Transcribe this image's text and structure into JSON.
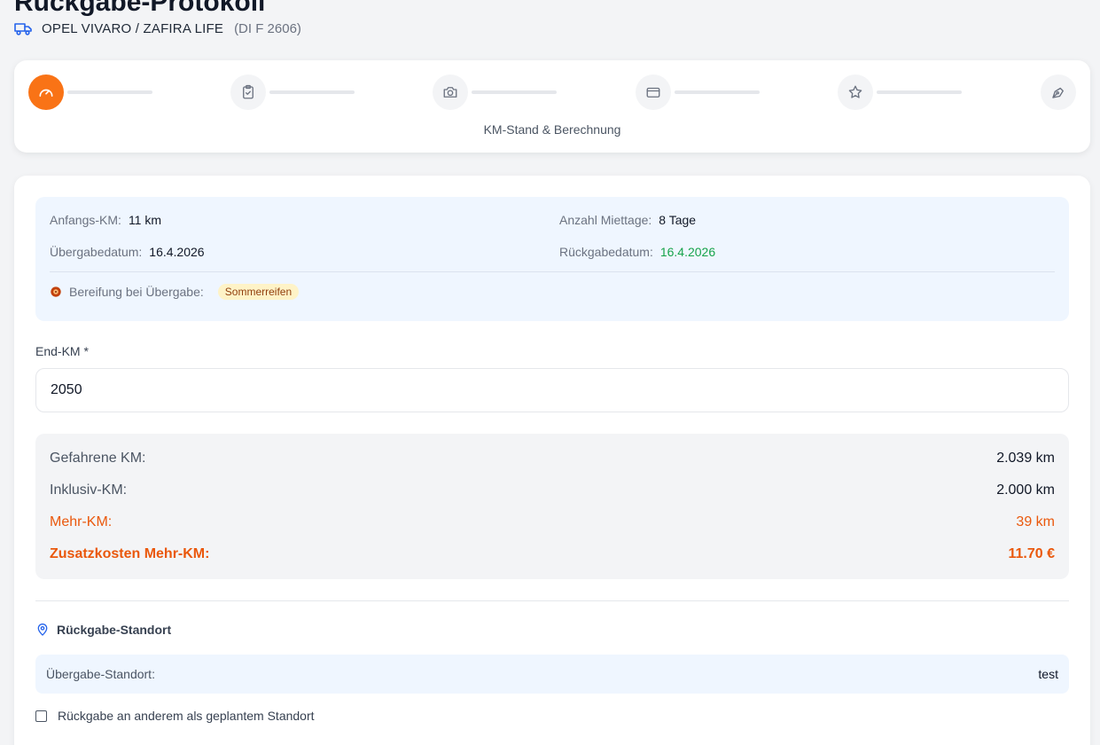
{
  "page": {
    "title": "Rückgabe-Protokoll",
    "vehicle_name": "OPEL VIVARO / ZAFIRA LIFE",
    "vehicle_plate": "(DI F 2606)"
  },
  "stepper": {
    "current_label": "KM-Stand & Berechnung",
    "steps": [
      {
        "icon": "speedometer-icon",
        "active": true
      },
      {
        "icon": "clipboard-check-icon",
        "active": false
      },
      {
        "icon": "camera-icon",
        "active": false
      },
      {
        "icon": "credit-card-icon",
        "active": false
      },
      {
        "icon": "star-icon",
        "active": false
      },
      {
        "icon": "signature-pen-icon",
        "active": false
      }
    ]
  },
  "info": {
    "start_km_label": "Anfangs-KM:",
    "start_km_value": "11 km",
    "rental_days_label": "Anzahl Miettage:",
    "rental_days_value": "8 Tage",
    "handover_date_label": "Übergabedatum:",
    "handover_date_value": "16.4.2026",
    "return_date_label": "Rückgabedatum:",
    "return_date_value": "16.4.2026",
    "tires_label": "Bereifung bei Übergabe:",
    "tires_value": "Sommerreifen"
  },
  "end_km": {
    "label": "End-KM *",
    "value": "2050"
  },
  "calculation": {
    "driven_label": "Gefahrene KM:",
    "driven_value": "2.039 km",
    "included_label": "Inklusiv-KM:",
    "included_value": "2.000 km",
    "extra_label": "Mehr-KM:",
    "extra_value": "39 km",
    "extra_cost_label": "Zusatzkosten Mehr-KM:",
    "extra_cost_value": "11.70 €"
  },
  "return_location": {
    "title": "Rückgabe-Standort",
    "handover_label": "Übergabe-Standort:",
    "handover_value": "test",
    "other_location_label": "Rückgabe an anderem als geplantem Standort"
  },
  "colors": {
    "accent": "#f97316",
    "orange_text": "#ea580c",
    "green_text": "#16a34a",
    "info_bg": "#eff6ff"
  }
}
